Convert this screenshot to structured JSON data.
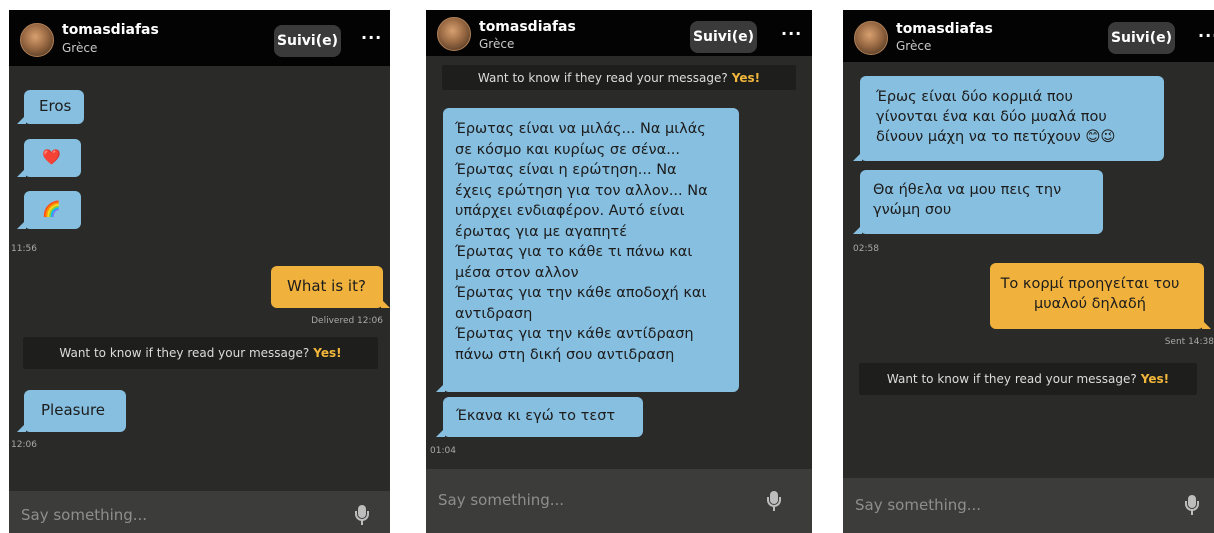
{
  "header": {
    "username": "tomasdiafas",
    "location": "Grèce",
    "follow_label": "Suivi(e)",
    "more_label": "···"
  },
  "notice": {
    "text": "Want to know if they read your message?",
    "cta": "Yes!"
  },
  "input": {
    "placeholder": "Say something..."
  },
  "panel1": {
    "msg_eros": "Eros",
    "msg_heart": "❤️",
    "msg_rainbow": "🌈",
    "ts_1156": "11:56",
    "msg_what": "What is it?",
    "status_delivered": "Delivered 12:06",
    "msg_pleasure": "Pleasure",
    "ts_1206": "12:06"
  },
  "panel2": {
    "long_lines": [
      "Έρωτας είναι να μιλάς... Να μιλάς",
      "σε κόσμο και κυρίως σε σένα...",
      "Έρωτας είναι η ερώτηση... Να",
      "έχεις ερώτηση για τον αλλον... Να",
      "υπάρχει ενδιαφέρον. Αυτό είναι",
      "έρωτας για με αγαπητέ",
      "Έρωτας για το κάθε τι πάνω και",
      "μέσα στον αλλον",
      "Έρωτας για την κάθε αποδοχή και",
      "αντιδραση",
      "Έρωτας για την κάθε αντίδραση",
      "πάνω στη δική σου αντιδραση"
    ],
    "msg_test": "Έκανα κι εγώ το τεστ",
    "ts_0104": "01:04"
  },
  "panel3": {
    "msg1_lines": [
      "Έρως είναι  δύο  κορμιά που",
      "γίνονται ένα  και δύο  μυαλά που",
      "δίνουν μάχη να το πετύχουν 😊😉"
    ],
    "msg2_lines": [
      "Θα ήθελα να  μου πεις την",
      "γνώμη σου"
    ],
    "ts_0258": "02:58",
    "out_lines": [
      "Το κορμί προηγείται του",
      "μυαλού δηλαδή"
    ],
    "status_sent": "Sent 14:38"
  },
  "colors": {
    "incoming": "#87bfe0",
    "outgoing": "#f0b23c",
    "panel_bg": "#2a2b29",
    "header_bg": "#030303",
    "accent_yes": "#f2b63b"
  },
  "icons": {
    "avatar": "profile-photo",
    "mic": "microphone-icon",
    "more": "more-dots-icon"
  }
}
